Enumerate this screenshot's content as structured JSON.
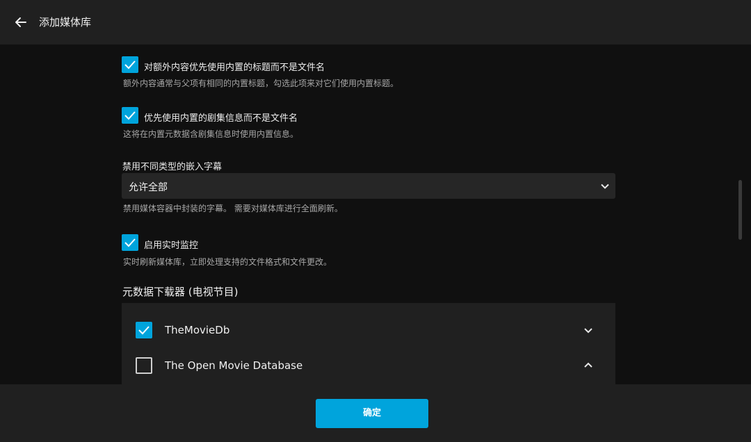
{
  "header": {
    "title": "添加媒体库",
    "back_icon": "arrow-left-icon"
  },
  "options": {
    "embedded_titles": {
      "label": "对额外内容优先使用内置的标题而不是文件名",
      "description": "额外内容通常与父项有相同的内置标题，勾选此项来对它们使用内置标题。",
      "checked": true
    },
    "embedded_episode_info": {
      "label": "优先使用内置的剧集信息而不是文件名",
      "description": "这将在内置元数据含剧集信息时使用内置信息。",
      "checked": true
    },
    "subtitles": {
      "label": "禁用不同类型的嵌入字幕",
      "value": "允许全部",
      "description": "禁用媒体容器中封装的字幕。 需要对媒体库进行全面刷新。"
    },
    "realtime_monitor": {
      "label": "启用实时监控",
      "description": "实时刷新媒体库，立即处理支持的文件格式和文件更改。",
      "checked": true
    }
  },
  "metadata": {
    "section_title": "元数据下载器 (电视节目)",
    "providers": [
      {
        "name": "TheMovieDb",
        "checked": true,
        "chevron": "chevron-down-icon"
      },
      {
        "name": "The Open Movie Database",
        "checked": false,
        "chevron": "chevron-up-icon"
      }
    ]
  },
  "footer": {
    "ok_label": "确定"
  },
  "colors": {
    "accent": "#00a4dc",
    "background": "#101010",
    "panel": "#202020"
  }
}
